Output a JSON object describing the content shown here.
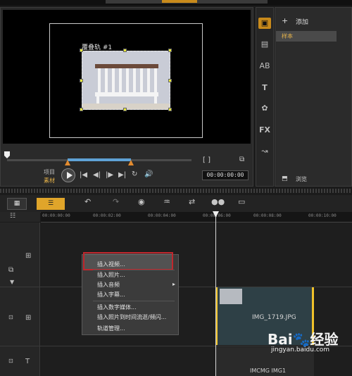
{
  "preview": {
    "overlay_title": "覆叠轨 #1",
    "project_label": "项目",
    "clip_label": "素材",
    "timecode": "00:00:00:00",
    "bracket_icons": "[  ]",
    "play_icon": "play-icon",
    "transport": [
      "|◀",
      "◀|",
      "|▶",
      "▶|",
      "↻",
      "🔊"
    ]
  },
  "library": {
    "add_label": "添加",
    "sample_item": "样本",
    "browse_label": "浏览"
  },
  "side_tools": [
    "media-icon",
    "instant-project-icon",
    "title-icon",
    "text-icon",
    "transition-icon",
    "fx-icon",
    "path-icon"
  ],
  "timeline": {
    "toolbar_buttons": [
      "storyboard-view",
      "timeline-view"
    ],
    "tools": [
      "undo-icon",
      "redo-icon",
      "record-icon",
      "audio-mix-icon",
      "motion-icon",
      "auto-music-icon",
      "subtitle-icon"
    ],
    "ruler_ticks": [
      "00:00:00:00",
      "00:00:02:00",
      "00:00:04:00",
      "00:00:06:00",
      "00:00:08:00",
      "00:00:10:00"
    ],
    "clip_name": "IMG_1719.JPG",
    "bottom_labels": "IMCMG   IMG1"
  },
  "context_menu": {
    "items": [
      {
        "label": "插入视频..."
      },
      {
        "label": "插入照片..."
      },
      {
        "label": "插入音频"
      },
      {
        "label": "插入字幕..."
      },
      {
        "label": "插入数字媒体..."
      },
      {
        "label": "插入照片到时间流逝/频闪..."
      },
      {
        "label": "轨道管理..."
      }
    ],
    "highlighted_index": 0
  },
  "watermark": {
    "brand": "Bai🐾经验",
    "url": "jingyan.baidu.com"
  },
  "colors": {
    "accent": "#e0a52a",
    "highlight_box": "#c0272d",
    "clip_bg": "#2e4046"
  }
}
